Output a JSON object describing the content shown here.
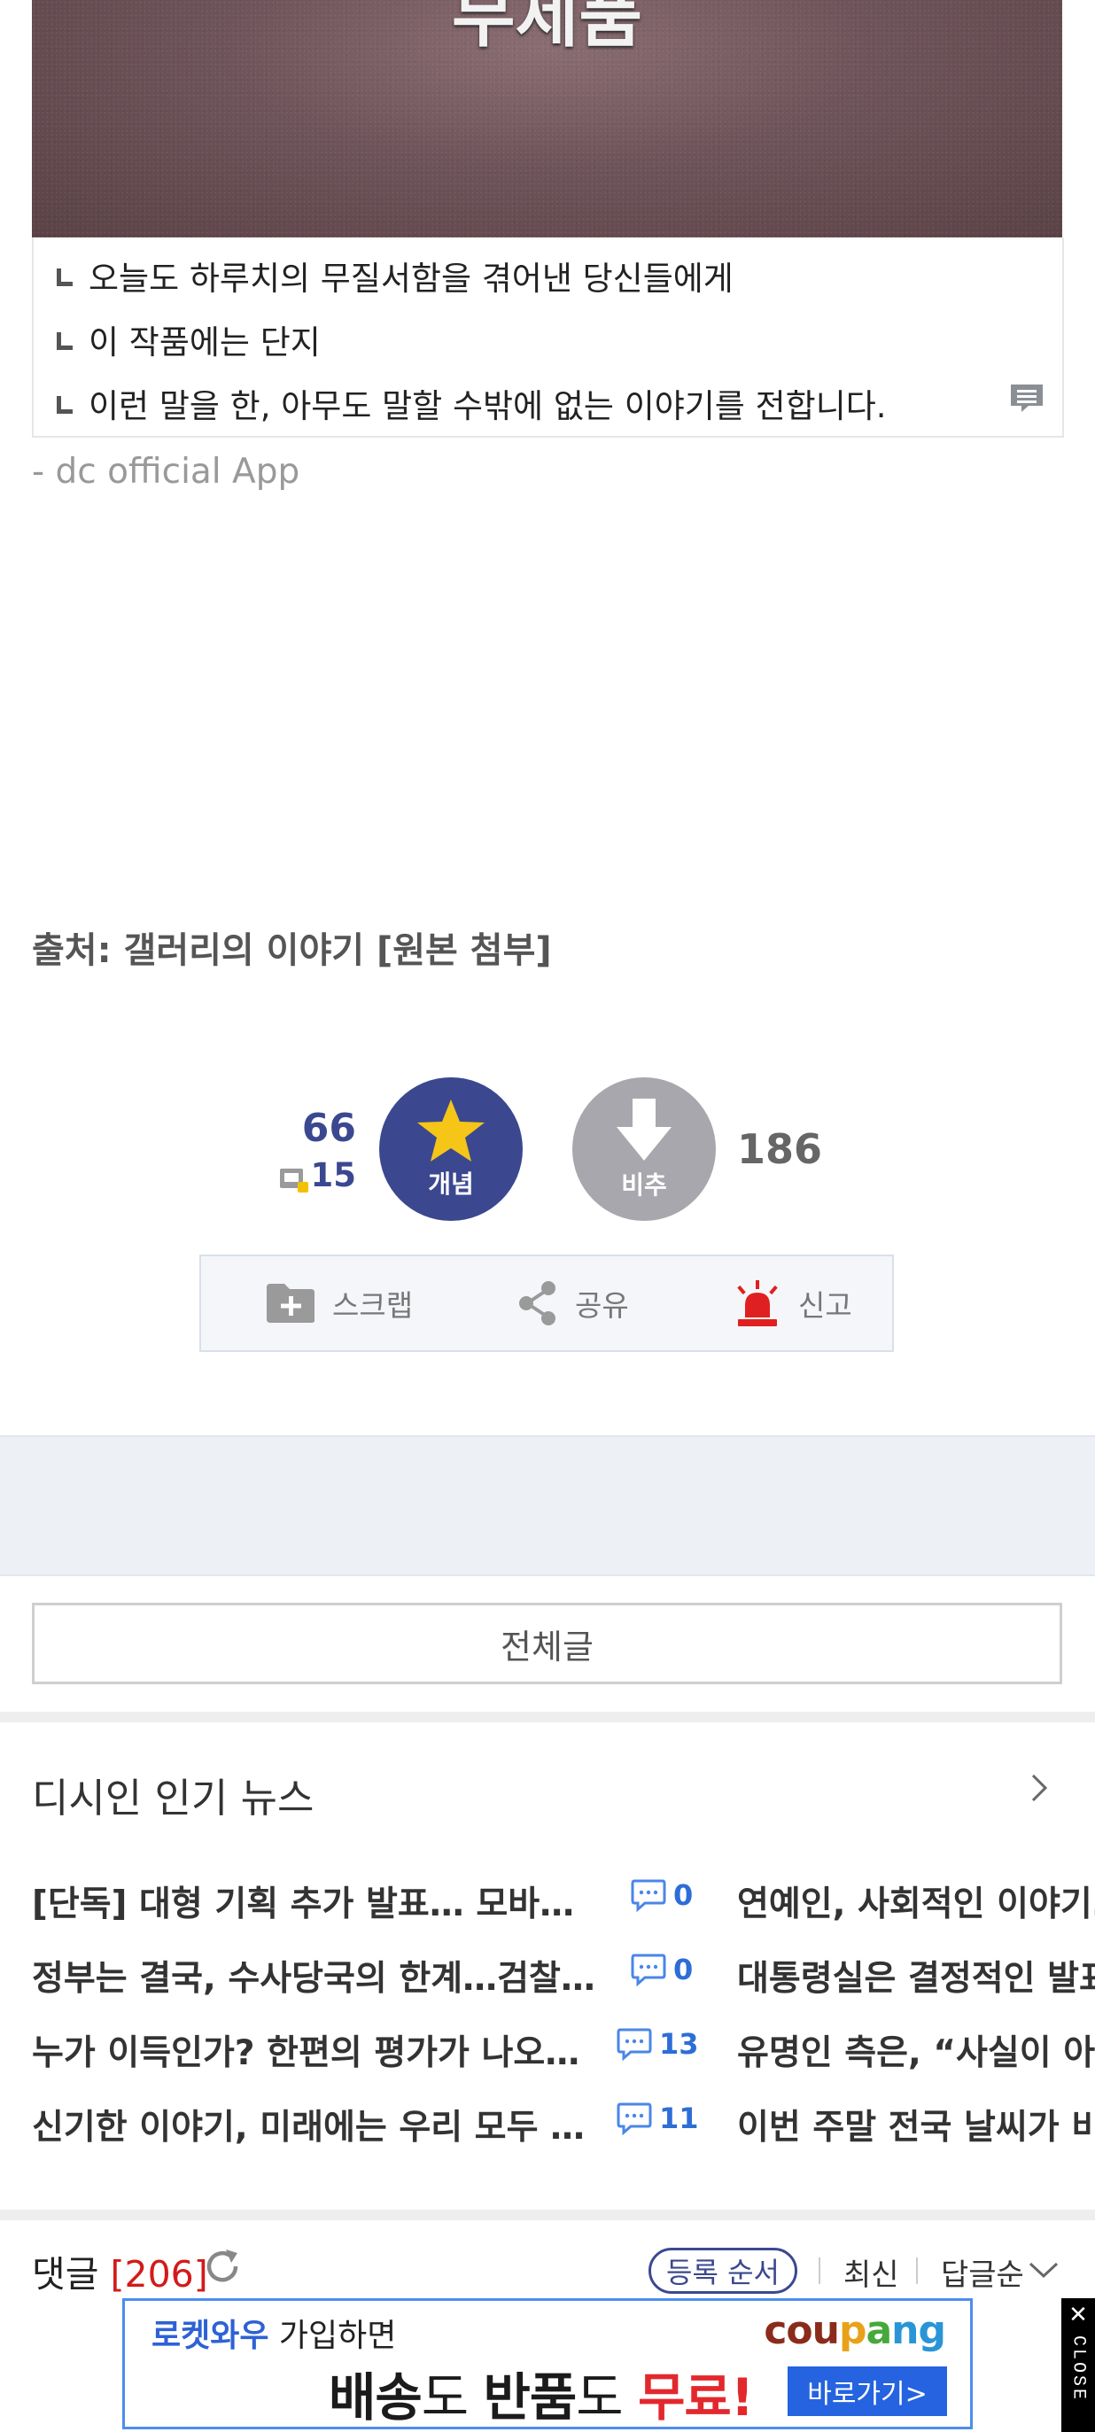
{
  "post": {
    "image_title": "무제품",
    "replies": [
      "오늘도 하루치의 무질서함을 겪어낸 당신들에게",
      "이 작품에는 단지",
      "이런 말을 한, 아무도 말할 수밖에 없는 이야기를 전합니다."
    ],
    "app_signature": "- dc official App",
    "source": "출처: 갤러리의 이야기 [원본 첨부]"
  },
  "vote": {
    "up_count": "66",
    "fix_count": "15",
    "up_label": "개념",
    "down_label": "비추",
    "down_count": "186"
  },
  "actions": {
    "scrap": "스크랩",
    "share": "공유",
    "report": "신고"
  },
  "list_button": "전체글",
  "news": {
    "title": "디시인 인기 뉴스",
    "rows": [
      {
        "title": "[단독] 대형 기획 추가 발표… 모바일 전…",
        "comments": "0",
        "right": "연예인, 사회적인 이야기…"
      },
      {
        "title": "정부는 결국, 수사당국의 한계…검찰이 …",
        "comments": "0",
        "right": "대통령실은 결정적인 발표"
      },
      {
        "title": "누가 이득인가? 한편의 평가가 나오는 오…",
        "comments": "13",
        "right": "유명인 측은, “사실이 아니"
      },
      {
        "title": "신기한 이야기, 미래에는 우리 모두 할 수…",
        "comments": "11",
        "right": "이번 주말 전국 날씨가 비"
      }
    ]
  },
  "comments": {
    "label": "댓글",
    "count": "[206]",
    "order_pill": "등록 순서",
    "tab1": "최신",
    "tab2": "답글순"
  },
  "ad": {
    "rocket": "로켓와우",
    "line1_rest": " 가입하면",
    "line2_a": "배송",
    "line2_b": "도 ",
    "line2_c": "반품",
    "line2_d": "도 ",
    "line2_free": "무료!",
    "logo": "coupang",
    "cta": "바로가기>",
    "close_x": "✕",
    "close_word": "CLOSE"
  },
  "colors": {
    "accent": "#3b4890",
    "comment_blue": "#2d6dd7",
    "count_red": "#d31a1a",
    "report_red": "#e02020"
  }
}
